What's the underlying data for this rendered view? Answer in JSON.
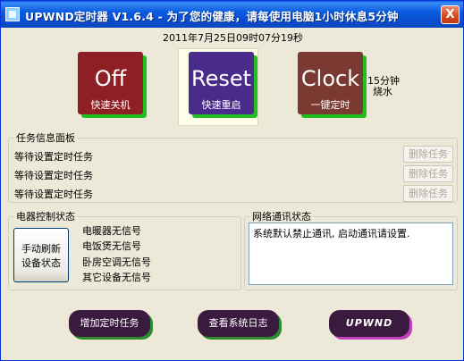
{
  "window": {
    "title": "UPWND定时器 V1.6.4 - 为了您的健康，请每使用电脑1小时休息5分钟",
    "close_label": "X"
  },
  "datetime": "2011年7月25日09时07分19秒",
  "quick_buttons": [
    {
      "big": "Off",
      "small": "快速关机",
      "color": "#8E1F24"
    },
    {
      "big": "Reset",
      "small": "快速重启",
      "color": "#4A2A8A"
    },
    {
      "big": "Clock",
      "small": "一键定时",
      "color": "#7A3A32"
    }
  ],
  "clock_note": {
    "line1": "15分钟",
    "line2": "烧水"
  },
  "task_panel": {
    "title": "任务信息面板",
    "tasks": [
      {
        "label": "等待设置定时任务",
        "delete_label": "删除任务"
      },
      {
        "label": "等待设置定时任务",
        "delete_label": "删除任务"
      },
      {
        "label": "等待设置定时任务",
        "delete_label": "删除任务"
      }
    ]
  },
  "device_panel": {
    "title": "电器控制状态",
    "refresh_line1": "手动刷新",
    "refresh_line2": "设备状态",
    "statuses": [
      "电暖器无信号",
      "电饭煲无信号",
      "卧房空调无信号",
      "其它设备无信号"
    ]
  },
  "network_panel": {
    "title": "网络通讯状态",
    "message": "系统默认禁止通讯, 启动通讯请设置."
  },
  "bottom_buttons": {
    "add_task": "增加定时任务",
    "view_log": "查看系统日志",
    "logo": "UPWND"
  }
}
